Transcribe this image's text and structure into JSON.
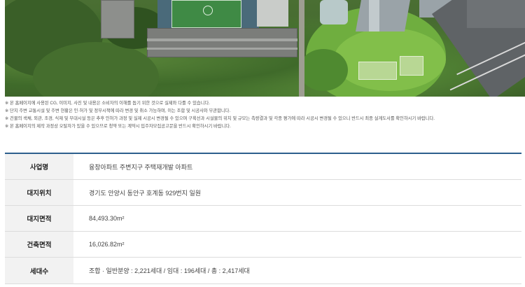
{
  "photo": {
    "alt_icon": "aerial-site-photo"
  },
  "notes": [
    "※ 본 홈페이지에 사용된 CG, 이미지, 사진 및 내용은 소비자의 이해를 돕기 위한 것으로 실제와 다를 수 있습니다.",
    "※ 단지 주변 교통시설 및 주변 현황은 인·허가 및 정부시책에 따라 변경 및 취소 가능하며, 이는 조합 및 시공사와 무관합니다.",
    "※ 건물의 색채, 외관, 조경, 식재 및 부대시설 등은 추후 인허가 과정 및 실제 시공시 변경될 수 있으며 구획선과 시설물의 위치 및 규모는 측량결과 및 각종 평가에 따라 시공시 변경될 수 있으니 반드시 최종 설계도서를 확인하시기 바랍니다.",
    "※ 본 홈페이지의 제작 과정상 오탈자가 있을 수 있으므로 청약 또는 계약시 입주자모집공고문을 반드시 확인하시기 바랍니다."
  ],
  "table": {
    "rows": [
      {
        "label": "사업명",
        "value": "융창아파트 주변지구 주택재개발 아파트"
      },
      {
        "label": "대지위치",
        "value": "경기도 안양시 동안구 호계동 929번지 일원"
      },
      {
        "label": "대지면적",
        "value": "84,493.30m²"
      },
      {
        "label": "건축면적",
        "value": "16,026.82m²"
      },
      {
        "label": "세대수",
        "value": "조합 · 일반분양 : 2,221세대 / 임대 : 196세대 / 총 : 2,417세대"
      }
    ]
  },
  "colors": {
    "table_top_border": "#2d5f8d",
    "header_bg": "#f2f2f2"
  }
}
